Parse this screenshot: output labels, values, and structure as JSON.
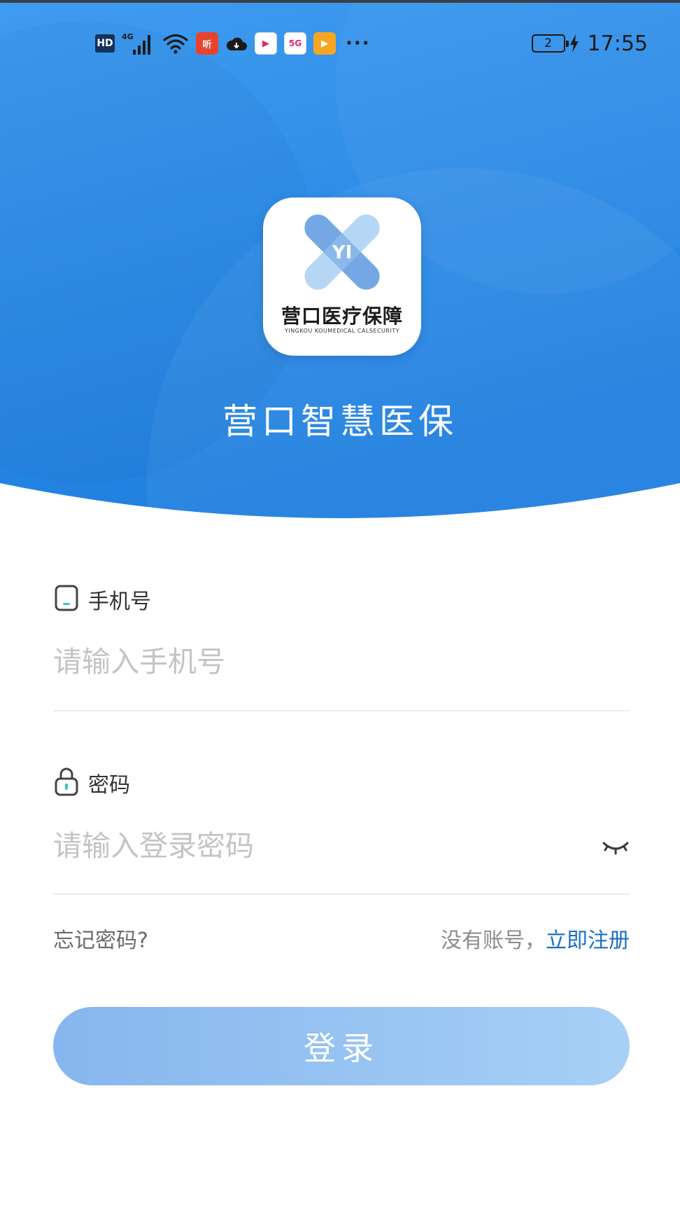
{
  "status_bar": {
    "hd_badge": "HD",
    "network": "4G",
    "app_badges": [
      {
        "name": "listen-app-icon",
        "label": "听",
        "color": "#e8432f"
      },
      {
        "name": "youku-app-icon",
        "label": "▶",
        "color": "#ffffff"
      },
      {
        "name": "5g-app-icon",
        "label": "5G",
        "color": "#ffffff"
      },
      {
        "name": "video-app-icon",
        "label": "▶",
        "color": "#f5a623"
      }
    ],
    "more": "···",
    "sim_slot": "2",
    "time": "17:55"
  },
  "header": {
    "logo_name": "营口医疗保障",
    "logo_subtitle": "YINGKOU KOUMEDICAL CALSECURITY",
    "logo_mark": "YI",
    "app_title": "营口智慧医保"
  },
  "form": {
    "phone_label": "手机号",
    "phone_placeholder": "请输入手机号",
    "password_label": "密码",
    "password_placeholder": "请输入登录密码",
    "forgot_password": "忘记密码?",
    "no_account": "没有账号，",
    "register": "立即注册",
    "login_button": "登录"
  },
  "colors": {
    "header_blue": "#2f8fe8",
    "link_blue": "#1a6fc4",
    "button_start": "#86b6ee",
    "button_end": "#a7d0f6"
  }
}
